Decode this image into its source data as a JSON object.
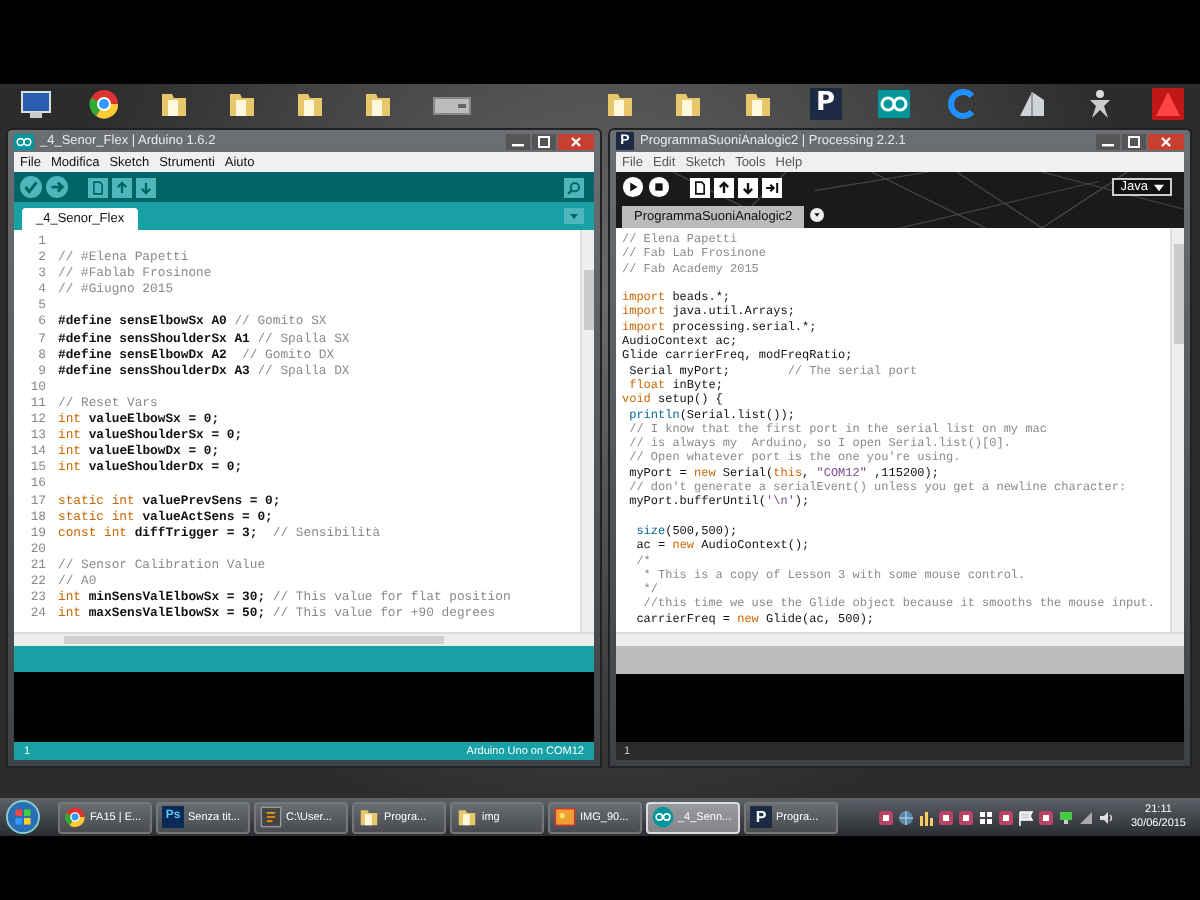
{
  "desktop_shortcuts": [
    {
      "kind": "computer"
    },
    {
      "kind": "browser"
    },
    {
      "kind": "folder"
    },
    {
      "kind": "folder"
    },
    {
      "kind": "folder"
    },
    {
      "kind": "folder"
    },
    {
      "kind": "drive"
    },
    {
      "kind": "gap"
    },
    {
      "kind": "folder"
    },
    {
      "kind": "folder"
    },
    {
      "kind": "folder"
    },
    {
      "kind": "processing",
      "glyph": "P"
    },
    {
      "kind": "arduino"
    },
    {
      "kind": "c-logo"
    },
    {
      "kind": "building"
    },
    {
      "kind": "figure"
    },
    {
      "kind": "triangle"
    }
  ],
  "arduino": {
    "title": "_4_Senor_Flex | Arduino 1.6.2",
    "menu": [
      "File",
      "Modifica",
      "Sketch",
      "Strumenti",
      "Aiuto"
    ],
    "tabs": [
      {
        "label": "_4_Senor_Flex",
        "selected": true
      }
    ],
    "lines": [
      {
        "n": "1"
      },
      {
        "n": "2",
        "seg": [
          {
            "kind": "comment",
            "text": "// #Elena Papetti"
          }
        ]
      },
      {
        "n": "3",
        "seg": [
          {
            "kind": "comment",
            "text": "// #Fablab Frosinone"
          }
        ]
      },
      {
        "n": "4",
        "seg": [
          {
            "kind": "comment",
            "text": "// #Giugno 2015"
          }
        ]
      },
      {
        "n": "5"
      },
      {
        "n": "6",
        "seg": [
          {
            "kind": "plain",
            "text": "#define sensElbowSx A0 "
          },
          {
            "kind": "comment",
            "text": "// Gomito SX"
          }
        ]
      },
      {
        "n": "7",
        "seg": [
          {
            "kind": "plain",
            "text": "#define sensShoulderSx A1 "
          },
          {
            "kind": "comment",
            "text": "// Spalla SX"
          }
        ]
      },
      {
        "n": "8",
        "seg": [
          {
            "kind": "plain",
            "text": "#define sensElbowDx A2  "
          },
          {
            "kind": "comment",
            "text": "// Gomito DX"
          }
        ]
      },
      {
        "n": "9",
        "seg": [
          {
            "kind": "plain",
            "text": "#define sensShoulderDx A3 "
          },
          {
            "kind": "comment",
            "text": "// Spalla DX"
          }
        ]
      },
      {
        "n": "10"
      },
      {
        "n": "11",
        "seg": [
          {
            "kind": "comment",
            "text": "// Reset Vars"
          }
        ]
      },
      {
        "n": "12",
        "seg": [
          {
            "kind": "keyword",
            "text": "int"
          },
          {
            "kind": "plain",
            "text": " valueElbowSx = 0;"
          }
        ]
      },
      {
        "n": "13",
        "seg": [
          {
            "kind": "keyword",
            "text": "int"
          },
          {
            "kind": "plain",
            "text": " valueShoulderSx = 0;"
          }
        ]
      },
      {
        "n": "14",
        "seg": [
          {
            "kind": "keyword",
            "text": "int"
          },
          {
            "kind": "plain",
            "text": " valueElbowDx = 0;"
          }
        ]
      },
      {
        "n": "15",
        "seg": [
          {
            "kind": "keyword",
            "text": "int"
          },
          {
            "kind": "plain",
            "text": " valueShoulderDx = 0;"
          }
        ]
      },
      {
        "n": "16"
      },
      {
        "n": "17",
        "seg": [
          {
            "kind": "keyword",
            "text": "static int"
          },
          {
            "kind": "plain",
            "text": " valuePrevSens = 0;"
          }
        ]
      },
      {
        "n": "18",
        "seg": [
          {
            "kind": "keyword",
            "text": "static int"
          },
          {
            "kind": "plain",
            "text": " valueActSens = 0;"
          }
        ]
      },
      {
        "n": "19",
        "seg": [
          {
            "kind": "keyword",
            "text": "const int"
          },
          {
            "kind": "plain",
            "text": " diffTrigger = 3;  "
          },
          {
            "kind": "comment",
            "text": "// Sensibilità"
          }
        ]
      },
      {
        "n": "20"
      },
      {
        "n": "21",
        "seg": [
          {
            "kind": "comment",
            "text": "// Sensor Calibration Value"
          }
        ]
      },
      {
        "n": "22",
        "seg": [
          {
            "kind": "comment",
            "text": "// A0"
          }
        ]
      },
      {
        "n": "23",
        "seg": [
          {
            "kind": "keyword",
            "text": "int"
          },
          {
            "kind": "plain",
            "text": " minSensValElbowSx = 30; "
          },
          {
            "kind": "comment",
            "text": "// This value for flat position"
          }
        ]
      },
      {
        "n": "24",
        "seg": [
          {
            "kind": "keyword",
            "text": "int"
          },
          {
            "kind": "plain",
            "text": " maxSensValElbowSx = 50; "
          },
          {
            "kind": "comment",
            "text": "// This value for +90 degrees"
          }
        ]
      }
    ],
    "status": {
      "line": "1",
      "board": "Arduino Uno on COM12"
    }
  },
  "processing": {
    "logo_glyph": "P",
    "title": "ProgrammaSuoniAnalogic2 | Processing 2.2.1",
    "menu": [
      "File",
      "Edit",
      "Sketch",
      "Tools",
      "Help"
    ],
    "mode": "Java",
    "tabs": [
      {
        "label": "ProgrammaSuoniAnalogic2",
        "selected": true
      }
    ],
    "lines": [
      {
        "kind": "code",
        "seg": [
          {
            "kind": "comment",
            "text": "// Elena Papetti"
          }
        ]
      },
      {
        "kind": "code",
        "seg": [
          {
            "kind": "comment",
            "text": "// Fab Lab Frosinone"
          }
        ]
      },
      {
        "kind": "code",
        "seg": [
          {
            "kind": "comment",
            "text": "// Fab Academy 2015"
          }
        ]
      },
      {
        "kind": "blank"
      },
      {
        "kind": "code",
        "seg": [
          {
            "kind": "keyword",
            "text": "import"
          },
          {
            "kind": "plain",
            "text": " beads.*;"
          }
        ]
      },
      {
        "kind": "code",
        "seg": [
          {
            "kind": "keyword",
            "text": "import"
          },
          {
            "kind": "plain",
            "text": " java.util.Arrays;"
          }
        ]
      },
      {
        "kind": "code",
        "seg": [
          {
            "kind": "keyword",
            "text": "import"
          },
          {
            "kind": "plain",
            "text": " processing.serial.*;"
          }
        ]
      },
      {
        "kind": "code",
        "seg": [
          {
            "kind": "plain",
            "text": "AudioContext ac;"
          }
        ]
      },
      {
        "kind": "code",
        "seg": [
          {
            "kind": "plain",
            "text": "Glide carrierFreq, modFreqRatio;"
          }
        ]
      },
      {
        "kind": "code",
        "seg": [
          {
            "kind": "plain",
            "text": " Serial myPort;        "
          },
          {
            "kind": "comment",
            "text": "// The serial port"
          }
        ]
      },
      {
        "kind": "code",
        "seg": [
          {
            "kind": "keyword",
            "text": " float"
          },
          {
            "kind": "plain",
            "text": " inByte;"
          }
        ]
      },
      {
        "kind": "code",
        "seg": [
          {
            "kind": "keyword",
            "text": "void"
          },
          {
            "kind": "plain",
            "text": " setup() {"
          }
        ]
      },
      {
        "kind": "code",
        "seg": [
          {
            "kind": "function",
            "text": " println"
          },
          {
            "kind": "plain",
            "text": "(Serial.list());"
          }
        ]
      },
      {
        "kind": "code",
        "seg": [
          {
            "kind": "comment",
            "text": " // I know that the first port in the serial list on my mac"
          }
        ]
      },
      {
        "kind": "code",
        "seg": [
          {
            "kind": "comment",
            "text": " // is always my  Arduino, so I open Serial.list()[0]."
          }
        ]
      },
      {
        "kind": "code",
        "seg": [
          {
            "kind": "comment",
            "text": " // Open whatever port is the one you're using."
          }
        ]
      },
      {
        "kind": "code",
        "seg": [
          {
            "kind": "plain",
            "text": " myPort = "
          },
          {
            "kind": "keyword",
            "text": "new"
          },
          {
            "kind": "plain",
            "text": " Serial("
          },
          {
            "kind": "keyword",
            "text": "this"
          },
          {
            "kind": "plain",
            "text": ", "
          },
          {
            "kind": "string",
            "text": "\"COM12\""
          },
          {
            "kind": "plain",
            "text": " ,115200);"
          }
        ]
      },
      {
        "kind": "code",
        "seg": [
          {
            "kind": "comment",
            "text": " // don't generate a serialEvent() unless you get a newline character:"
          }
        ]
      },
      {
        "kind": "code",
        "seg": [
          {
            "kind": "plain",
            "text": " myPort.bufferUntil("
          },
          {
            "kind": "string",
            "text": "'\\n'"
          },
          {
            "kind": "plain",
            "text": ");"
          }
        ]
      },
      {
        "kind": "blank"
      },
      {
        "kind": "code",
        "seg": [
          {
            "kind": "function",
            "text": "  size"
          },
          {
            "kind": "plain",
            "text": "(500,500);"
          }
        ]
      },
      {
        "kind": "code",
        "seg": [
          {
            "kind": "plain",
            "text": "  ac = "
          },
          {
            "kind": "keyword",
            "text": "new"
          },
          {
            "kind": "plain",
            "text": " AudioContext();"
          }
        ]
      },
      {
        "kind": "code",
        "seg": [
          {
            "kind": "comment",
            "text": "  /*"
          }
        ]
      },
      {
        "kind": "code",
        "seg": [
          {
            "kind": "comment",
            "text": "   * This is a copy of Lesson 3 with some mouse control."
          }
        ]
      },
      {
        "kind": "code",
        "seg": [
          {
            "kind": "comment",
            "text": "   */"
          }
        ]
      },
      {
        "kind": "code",
        "seg": [
          {
            "kind": "comment",
            "text": "   //this time we use the Glide object because it smooths the mouse input."
          }
        ]
      },
      {
        "kind": "code",
        "seg": [
          {
            "kind": "plain",
            "text": "  carrierFreq = "
          },
          {
            "kind": "keyword",
            "text": "new"
          },
          {
            "kind": "plain",
            "text": " Glide(ac, 500);"
          }
        ]
      }
    ],
    "status": {
      "line": "1"
    }
  },
  "taskbar": {
    "items": [
      {
        "kind": "browser",
        "label": "FA15 | E...",
        "selected": false
      },
      {
        "kind": "photoshop",
        "glyph": "Ps",
        "label": "Senza tit...",
        "selected": false
      },
      {
        "kind": "editor",
        "label": "C:\\User...",
        "selected": false
      },
      {
        "kind": "folder",
        "label": "Progra...",
        "selected": false
      },
      {
        "kind": "folder",
        "label": "img",
        "selected": false
      },
      {
        "kind": "image",
        "label": "IMG_90...",
        "selected": false
      },
      {
        "kind": "arduino",
        "label": "_4_Senn...",
        "selected": true
      },
      {
        "kind": "processing",
        "glyph": "P",
        "label": "Progra...",
        "selected": false
      }
    ],
    "clock": {
      "time": "21:11",
      "date": "30/06/2015"
    }
  }
}
